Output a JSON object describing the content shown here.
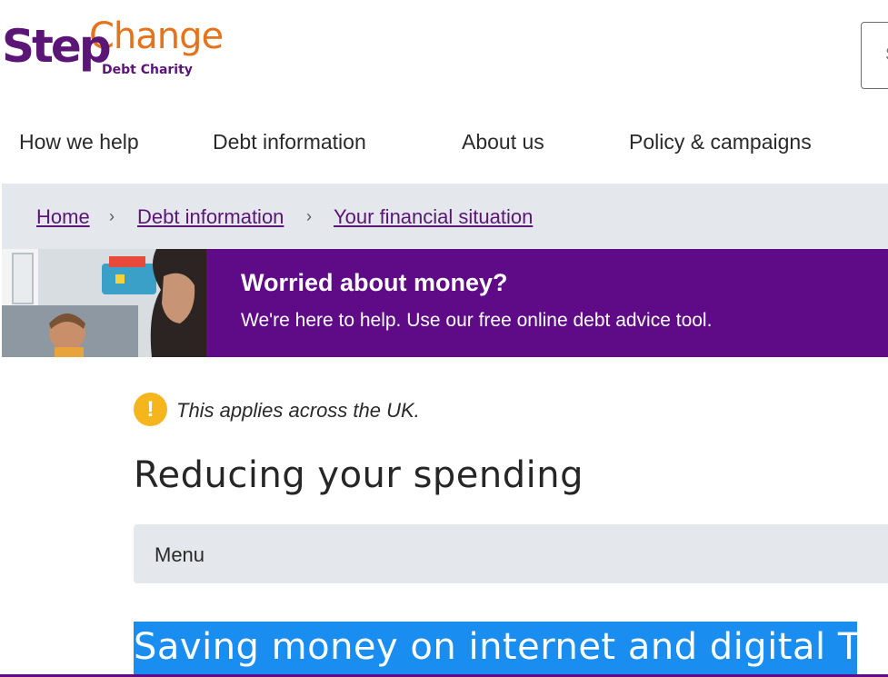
{
  "logo": {
    "step": "Step",
    "change": "Change",
    "sub": "Debt Charity"
  },
  "search": {
    "placeholder": "S"
  },
  "nav": [
    "How we help",
    "Debt information",
    "About us",
    "Policy & campaigns"
  ],
  "breadcrumb": {
    "home": "Home",
    "sep": "›",
    "debt_information": "Debt information",
    "financial_situation": "Your financial situation"
  },
  "banner": {
    "title": "Worried about money?",
    "subtitle": "We're here to help. Use our free online debt advice tool."
  },
  "notice": {
    "icon": "!",
    "text": "This applies across the UK."
  },
  "page_title": "Reducing your spending",
  "menu": {
    "label": "Menu"
  },
  "section_title": "Saving money on internet and digital TV",
  "colors": {
    "purple": "#5f0a87",
    "orange": "#e5731c",
    "highlight": "#1a8ef0",
    "warning": "#f5b51c"
  }
}
